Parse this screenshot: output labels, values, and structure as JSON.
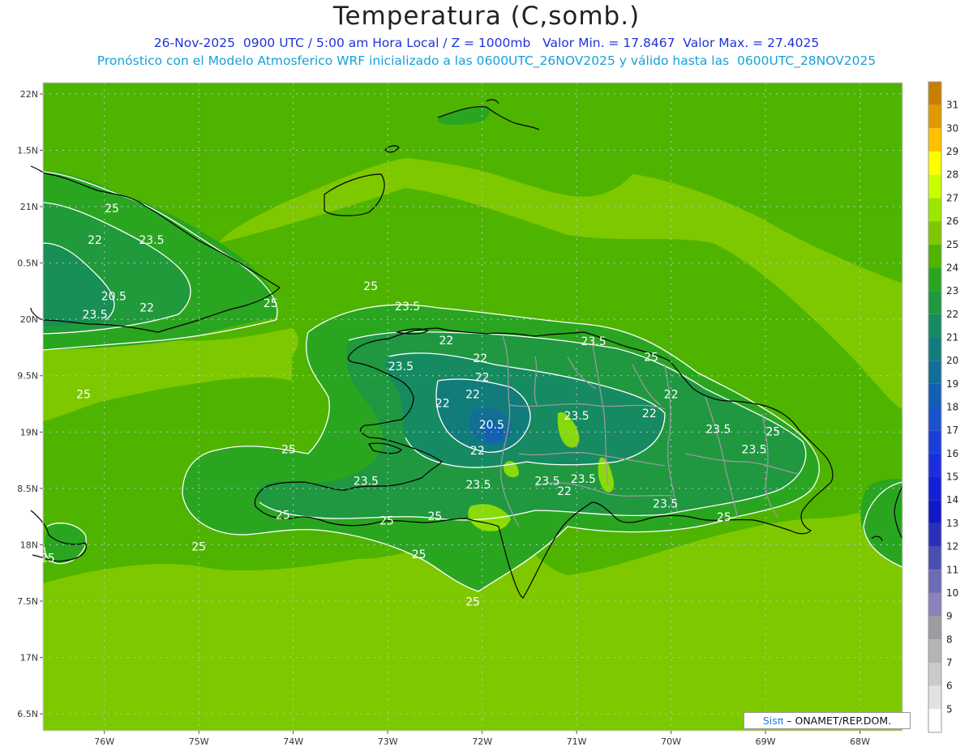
{
  "header": {
    "title": "Temperatura (C,somb.)",
    "subtitle_line1": "26-Nov-2025  0900 UTC / 5:00 am Hora Local / Z = 1000mb   Valor Min. = 17.8467  Valor Max. = 27.4025",
    "subtitle_line2": "Pronóstico con el Modelo Atmosferico WRF inicializado a las 0600UTC_26NOV2025 y válido hasta las  0600UTC_28NOV2025"
  },
  "axes": {
    "lon_labels": [
      "76W",
      "75W",
      "74W",
      "73W",
      "72W",
      "71W",
      "70W",
      "69W",
      "68W"
    ],
    "lat_labels": [
      "22N",
      "1.5N",
      "21N",
      "0.5N",
      "20N",
      "9.5N",
      "19N",
      "8.5N",
      "18N",
      "7.5N",
      "17N",
      "6.5N"
    ]
  },
  "colorbar": {
    "levels": [
      {
        "label": "31",
        "color": "#c87f00"
      },
      {
        "label": "30",
        "color": "#e09a00"
      },
      {
        "label": "29",
        "color": "#ffc000"
      },
      {
        "label": "28",
        "color": "#ffff00"
      },
      {
        "label": "27",
        "color": "#c8ff00"
      },
      {
        "label": "26",
        "color": "#9ce600"
      },
      {
        "label": "25",
        "color": "#7ec800"
      },
      {
        "label": "24",
        "color": "#4fb400"
      },
      {
        "label": "23",
        "color": "#2aa520"
      },
      {
        "label": "22",
        "color": "#1f9840"
      },
      {
        "label": "21",
        "color": "#168a60"
      },
      {
        "label": "20",
        "color": "#127c7c"
      },
      {
        "label": "19",
        "color": "#126e96"
      },
      {
        "label": "18",
        "color": "#1260b4"
      },
      {
        "label": "17",
        "color": "#1a52cc"
      },
      {
        "label": "16",
        "color": "#1a3ed8"
      },
      {
        "label": "15",
        "color": "#1a2ee0"
      },
      {
        "label": "14",
        "color": "#1420d8"
      },
      {
        "label": "13",
        "color": "#1018c8"
      },
      {
        "label": "12",
        "color": "#2a30b8"
      },
      {
        "label": "11",
        "color": "#4a50b0"
      },
      {
        "label": "10",
        "color": "#6a6cb4"
      },
      {
        "label": "9",
        "color": "#8a82b8"
      },
      {
        "label": "8",
        "color": "#9c9ca0"
      },
      {
        "label": "7",
        "color": "#b4b4b4"
      },
      {
        "label": "6",
        "color": "#cacaca"
      },
      {
        "label": "5",
        "color": "#e2e2e2"
      },
      {
        "label": "",
        "color": "#ffffff"
      }
    ]
  },
  "contour_labels": [
    {
      "text": "25",
      "lon": -75.92,
      "lat": 20.95
    },
    {
      "text": "22",
      "lon": -76.1,
      "lat": 20.67
    },
    {
      "text": "23.5",
      "lon": -75.5,
      "lat": 20.67
    },
    {
      "text": "20.5",
      "lon": -75.9,
      "lat": 20.17
    },
    {
      "text": "22",
      "lon": -75.55,
      "lat": 20.07
    },
    {
      "text": "23.5",
      "lon": -76.1,
      "lat": 20.01
    },
    {
      "text": "25",
      "lon": -74.24,
      "lat": 20.11
    },
    {
      "text": "25",
      "lon": -73.18,
      "lat": 20.26
    },
    {
      "text": "23.5",
      "lon": -72.79,
      "lat": 20.08
    },
    {
      "text": "22",
      "lon": -72.38,
      "lat": 19.78
    },
    {
      "text": "23.5",
      "lon": -70.82,
      "lat": 19.77
    },
    {
      "text": "25",
      "lon": -70.21,
      "lat": 19.63
    },
    {
      "text": "22",
      "lon": -72.02,
      "lat": 19.62
    },
    {
      "text": "23.5",
      "lon": -72.86,
      "lat": 19.55
    },
    {
      "text": "22",
      "lon": -72.0,
      "lat": 19.45
    },
    {
      "text": "22",
      "lon": -72.1,
      "lat": 19.3
    },
    {
      "text": "22",
      "lon": -70.0,
      "lat": 19.3
    },
    {
      "text": "25",
      "lon": -76.22,
      "lat": 19.3
    },
    {
      "text": "22",
      "lon": -72.42,
      "lat": 19.22
    },
    {
      "text": "23.5",
      "lon": -71.0,
      "lat": 19.11
    },
    {
      "text": "22",
      "lon": -70.23,
      "lat": 19.13
    },
    {
      "text": "20.5",
      "lon": -71.9,
      "lat": 19.03
    },
    {
      "text": "23.5",
      "lon": -69.5,
      "lat": 18.99
    },
    {
      "text": "25",
      "lon": -68.92,
      "lat": 18.97
    },
    {
      "text": "22",
      "lon": -72.05,
      "lat": 18.8
    },
    {
      "text": "23.5",
      "lon": -69.12,
      "lat": 18.81
    },
    {
      "text": "25",
      "lon": -74.05,
      "lat": 18.81
    },
    {
      "text": "23.5",
      "lon": -73.23,
      "lat": 18.53
    },
    {
      "text": "23.5",
      "lon": -72.04,
      "lat": 18.5
    },
    {
      "text": "23.5",
      "lon": -71.31,
      "lat": 18.53
    },
    {
      "text": "23.5",
      "lon": -70.93,
      "lat": 18.55
    },
    {
      "text": "22",
      "lon": -71.13,
      "lat": 18.44
    },
    {
      "text": "23.5",
      "lon": -70.06,
      "lat": 18.33
    },
    {
      "text": "25",
      "lon": -74.11,
      "lat": 18.23
    },
    {
      "text": "25",
      "lon": -73.01,
      "lat": 18.18
    },
    {
      "text": "25",
      "lon": -72.5,
      "lat": 18.22
    },
    {
      "text": "25",
      "lon": -69.44,
      "lat": 18.21
    },
    {
      "text": "25",
      "lon": -75.0,
      "lat": 17.95
    },
    {
      "text": "25",
      "lon": -76.6,
      "lat": 17.85
    },
    {
      "text": "25",
      "lon": -72.67,
      "lat": 17.88
    },
    {
      "text": "25",
      "lon": -72.1,
      "lat": 17.46
    }
  ],
  "footer": {
    "brand": "Sisπ",
    "agency": " – ONAMET/REP.DOM."
  }
}
